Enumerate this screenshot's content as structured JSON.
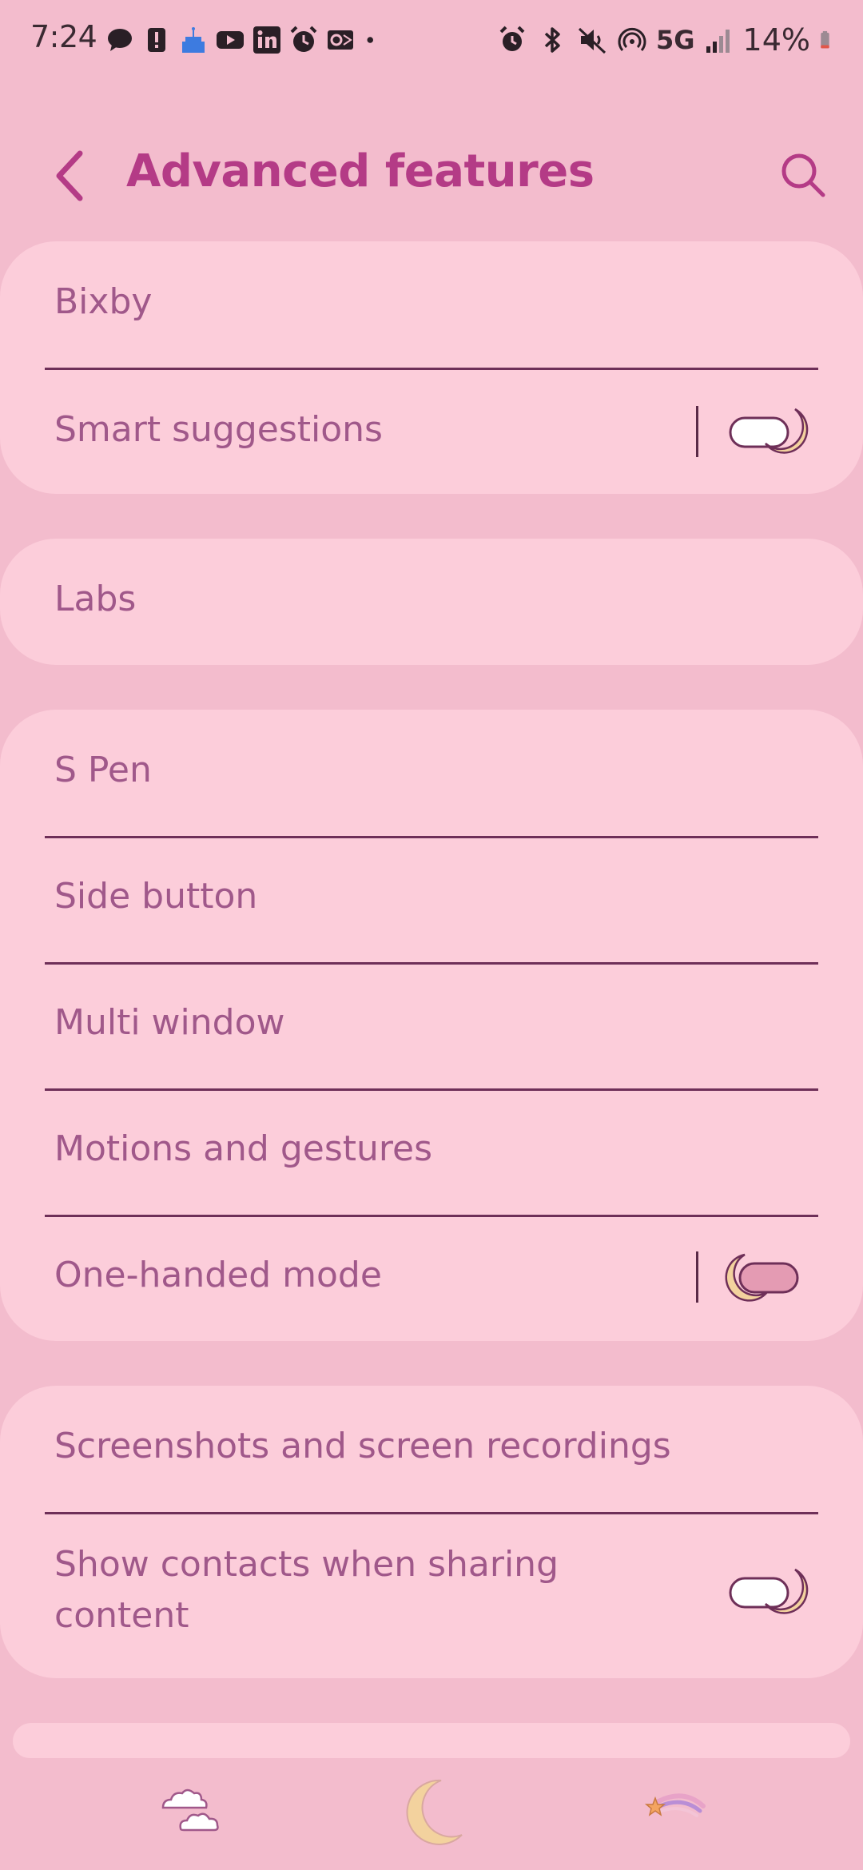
{
  "status_bar": {
    "time": "7:24",
    "network": "5G",
    "battery_percent": "14%",
    "left_icons": [
      "chat-icon",
      "alert-icon",
      "cake-icon",
      "youtube-icon",
      "linkedin-icon",
      "alarm-icon",
      "outlook-icon",
      "dot-icon"
    ],
    "right_icons": [
      "alarm-icon",
      "bluetooth-icon",
      "mute-icon",
      "hotspot-icon",
      "signal-icon",
      "battery-icon"
    ]
  },
  "header": {
    "title": "Advanced features",
    "back_icon": "back-chevron-icon",
    "search_icon": "search-icon"
  },
  "groups": [
    {
      "items": [
        {
          "label": "Bixby",
          "has_toggle": false
        },
        {
          "label": "Smart suggestions",
          "has_toggle": true,
          "toggle_on": false
        }
      ]
    },
    {
      "items": [
        {
          "label": "Labs",
          "has_toggle": false
        }
      ]
    },
    {
      "items": [
        {
          "label": "S Pen",
          "has_toggle": false
        },
        {
          "label": "Side button",
          "has_toggle": false
        },
        {
          "label": "Multi window",
          "has_toggle": false
        },
        {
          "label": "Motions and gestures",
          "has_toggle": false
        },
        {
          "label": "One-handed mode",
          "has_toggle": true,
          "toggle_on": true
        }
      ]
    },
    {
      "items": [
        {
          "label": "Screenshots and screen recordings",
          "has_toggle": false
        },
        {
          "label": "Show contacts when sharing",
          "label_line2": "content",
          "has_toggle": true,
          "toggle_on": false
        }
      ]
    }
  ],
  "bottom_nav": {
    "items": [
      "recent-apps-cloud-icon",
      "home-moon-icon",
      "back-shooting-star-icon"
    ]
  },
  "colors": {
    "background": "#f3bccd",
    "card": "#fccdda",
    "title": "#b43b86",
    "label": "#a0588a",
    "divider": "#6e2f58",
    "moon": "#f3d29e"
  }
}
